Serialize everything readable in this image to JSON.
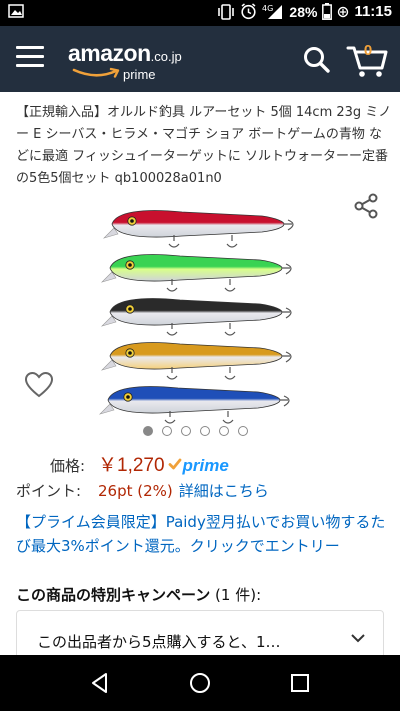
{
  "status_bar": {
    "battery_percent": "28%",
    "network": "4G",
    "time": "11:15"
  },
  "header": {
    "logo_word": "amazon",
    "logo_tld": ".co.jp",
    "logo_prime": "prime",
    "cart_count": "0"
  },
  "product": {
    "title": "【正規輸入品】オルルド釣具 ルアーセット 5個 14cm 23g ミノー E シーバス・ヒラメ・マゴチ ショア ボートゲームの青物 などに最適 フィッシュイーターゲットに ソルトウォーターー定番の5色5個セット qb100028a01n0",
    "image_dots": 6,
    "active_dot": 0,
    "lure_colors": [
      "#c8102e",
      "#39d353",
      "#2a2a2a",
      "#d89a1e",
      "#1f4fb8"
    ]
  },
  "price": {
    "label": "価格:",
    "value": "￥1,270",
    "prime_badge": "prime"
  },
  "points": {
    "label": "ポイント:",
    "value": "26pt  (2%)",
    "link": "詳細はこちら"
  },
  "promo": {
    "text": "【プライム会員限定】Paidy翌月払いでお買い物するたび最大3%ポイント還元。クリックでエントリー"
  },
  "campaign": {
    "title": "この商品の特別キャンペーン",
    "count": "(1 件):",
    "item": "この出品者から5点購入すると、1…"
  },
  "colors": {
    "header_bg": "#232f3e",
    "price_red": "#b12704",
    "link_blue": "#0066c0",
    "prime_blue": "#1a98ff",
    "cart_orange": "#f0a13a"
  }
}
